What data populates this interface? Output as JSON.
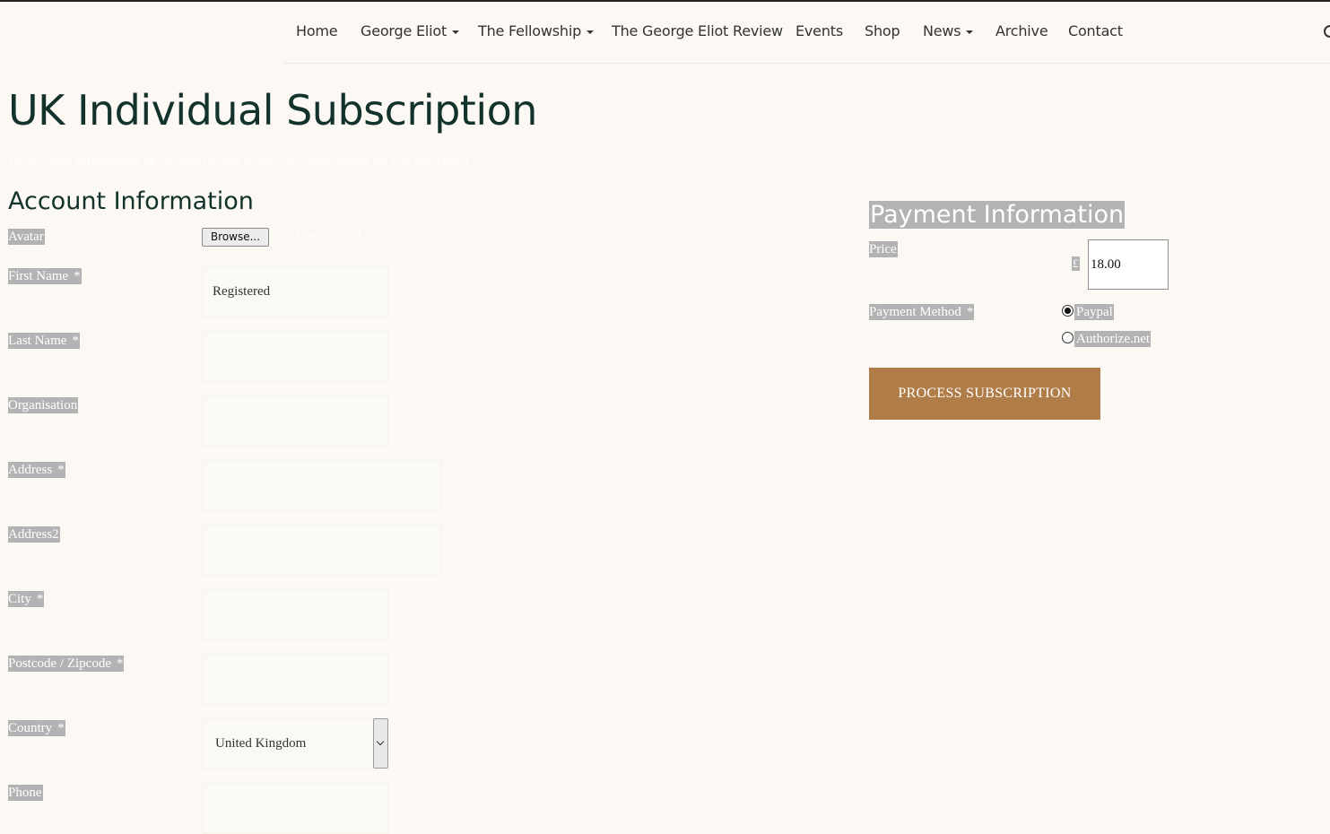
{
  "nav": {
    "items": [
      {
        "label": "Home",
        "dropdown": false
      },
      {
        "label": "George Eliot",
        "dropdown": true
      },
      {
        "label": "The Fellowship",
        "dropdown": true
      },
      {
        "label": "The George Eliot Review",
        "dropdown": false
      },
      {
        "label": "Events",
        "dropdown": false
      },
      {
        "label": "Shop",
        "dropdown": false
      },
      {
        "label": "News",
        "dropdown": true
      },
      {
        "label": "Archive",
        "dropdown": false
      },
      {
        "label": "Contact",
        "dropdown": false
      }
    ],
    "search_icon": "search-icon"
  },
  "page": {
    "title": "UK Individual Subscription",
    "intro": "Please enter information on the form below to process subscription for UK Individual"
  },
  "account": {
    "title": "Account Information",
    "avatar_label": "Avatar",
    "browse_label": "Browse...",
    "file_status": "No file selected.",
    "first_name_label": "First Name",
    "first_name_value": "Registered",
    "last_name_label": "Last Name",
    "organisation_label": "Organisation",
    "address_label": "Address",
    "address2_label": "Address2",
    "city_label": "City",
    "postcode_label": "Postcode / Zipcode",
    "country_label": "Country",
    "country_value": "United Kingdom",
    "phone_label": "Phone",
    "required_mark": "*"
  },
  "payment": {
    "title": "Payment Information",
    "price_label": "Price",
    "currency": "£",
    "price_value": "18.00",
    "method_label": "Payment Method",
    "methods": [
      {
        "label": "Paypal",
        "checked": true
      },
      {
        "label": "Authorize.net",
        "checked": false
      }
    ],
    "submit_label": "PROCESS SUBSCRIPTION"
  },
  "colors": {
    "background": "#fcf8f3",
    "heading": "#12322b",
    "button": "#b07d49",
    "label_highlight": "#b3b3b3"
  }
}
